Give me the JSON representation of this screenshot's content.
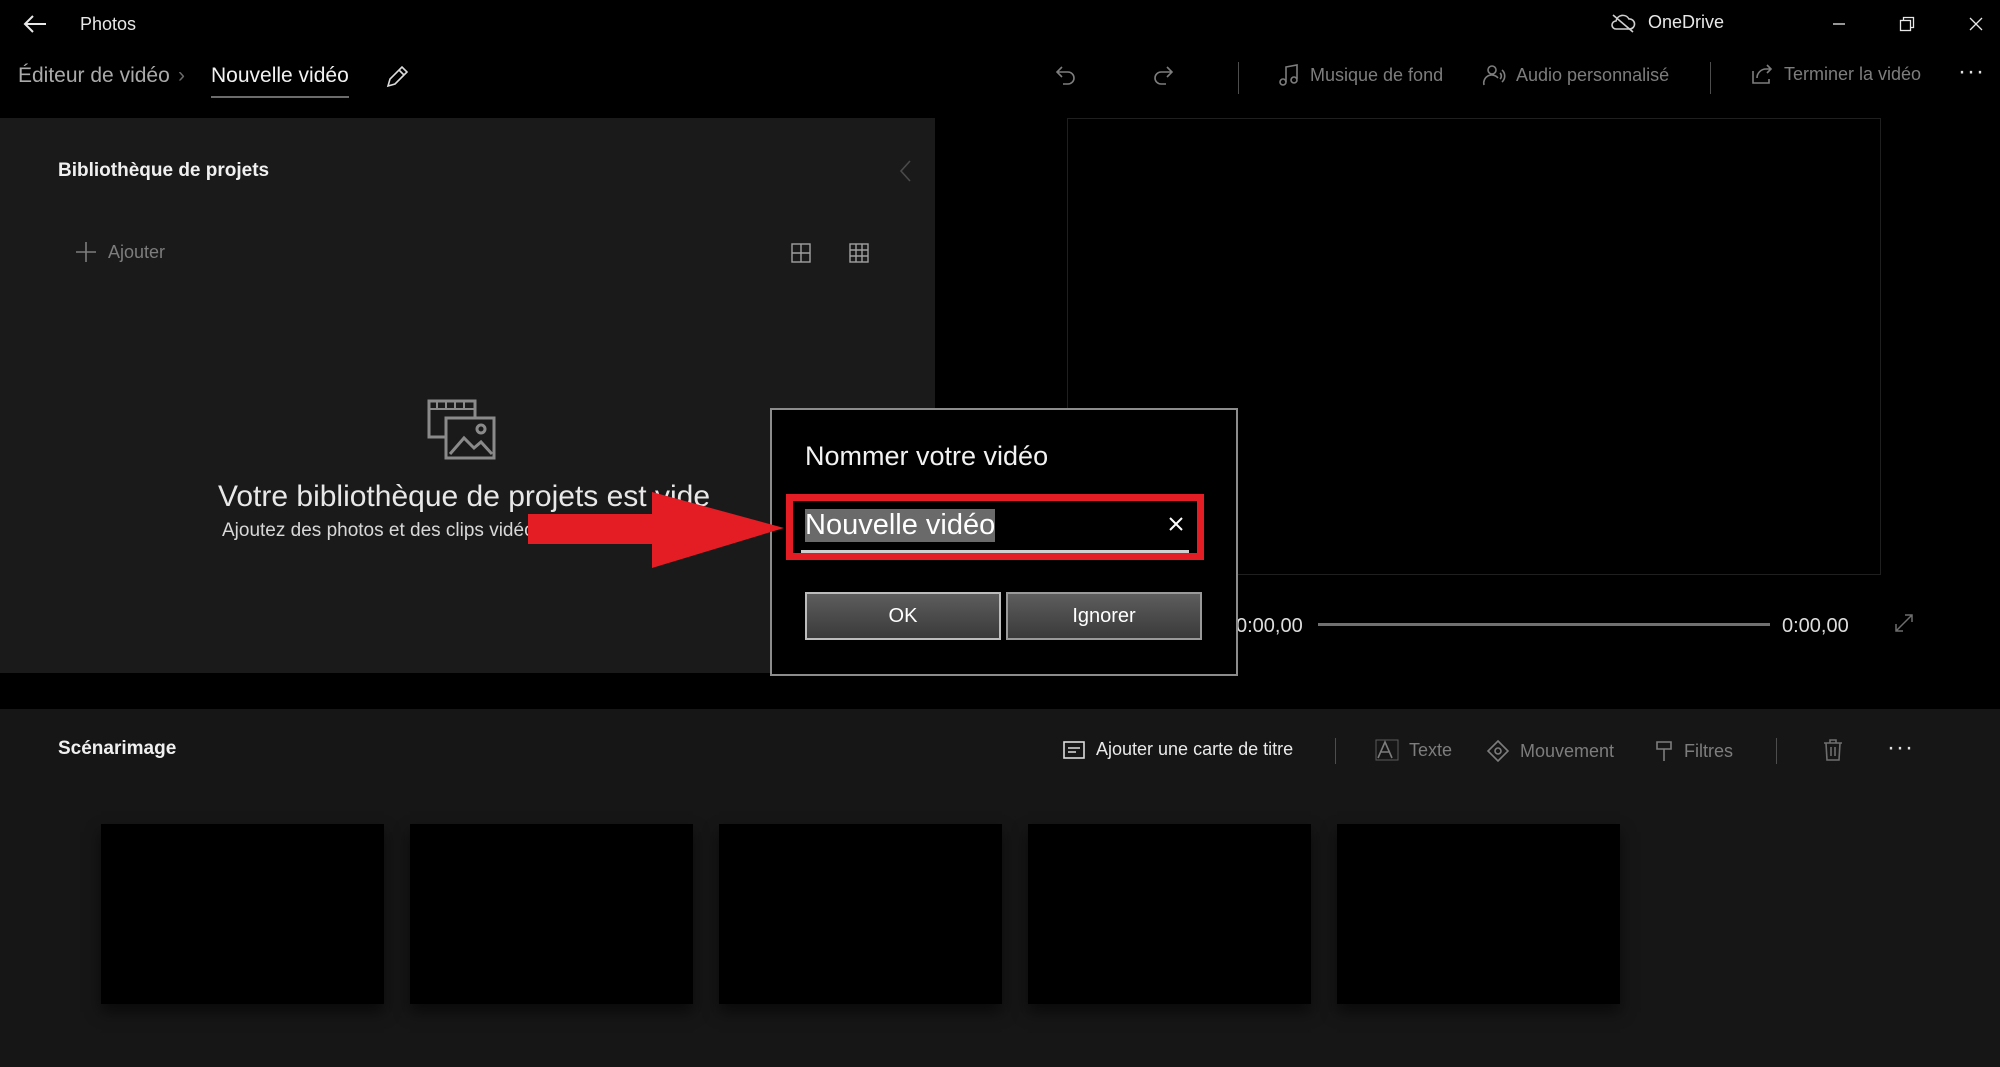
{
  "app": {
    "title": "Photos",
    "onedrive_label": "OneDrive"
  },
  "breadcrumb": {
    "parent": "Éditeur de vidéo",
    "separator": "›",
    "current": "Nouvelle vidéo"
  },
  "toolbar": {
    "music_label": "Musique de fond",
    "custom_audio_label": "Audio personnalisé",
    "finish_label": "Terminer la vidéo",
    "more_label": "···"
  },
  "library": {
    "title": "Bibliothèque de projets",
    "add_label": "Ajouter",
    "empty_title": "Votre bibliothèque de projets est vide",
    "empty_subtitle": "Ajoutez des photos et des clips vidéo"
  },
  "preview": {
    "time_start": "0:00,00",
    "time_end": "0:00,00",
    "progress": 0
  },
  "storyboard": {
    "title": "Scénarimage",
    "title_card_label": "Ajouter une carte de titre",
    "text_label": "Texte",
    "motion_label": "Mouvement",
    "filters_label": "Filtres",
    "more_label": "···",
    "card_count": 5
  },
  "dialog": {
    "title": "Nommer votre vidéo",
    "input_value": "Nouvelle vidéo",
    "ok_label": "OK",
    "ignore_label": "Ignorer"
  },
  "colors": {
    "annotation_red": "#e41c24",
    "background": "#000000",
    "panel": "#1a1a1a"
  },
  "icons": {
    "back": "back-arrow-icon",
    "cloud": "cloud-off-icon",
    "undo": "undo-icon",
    "redo": "redo-icon",
    "music": "music-note-icon",
    "audio": "person-audio-icon",
    "share": "share-icon",
    "edit": "pencil-icon",
    "collapse": "chevron-left-icon",
    "grid_large": "grid-large-icon",
    "grid_small": "grid-small-icon",
    "library": "photo-library-icon",
    "fullscreen": "expand-icon",
    "title_card": "title-card-icon",
    "text": "text-icon",
    "motion": "motion-icon",
    "filters": "filter-icon",
    "trash": "trash-icon",
    "clear": "close-icon",
    "annotation": "red-arrow-icon"
  }
}
